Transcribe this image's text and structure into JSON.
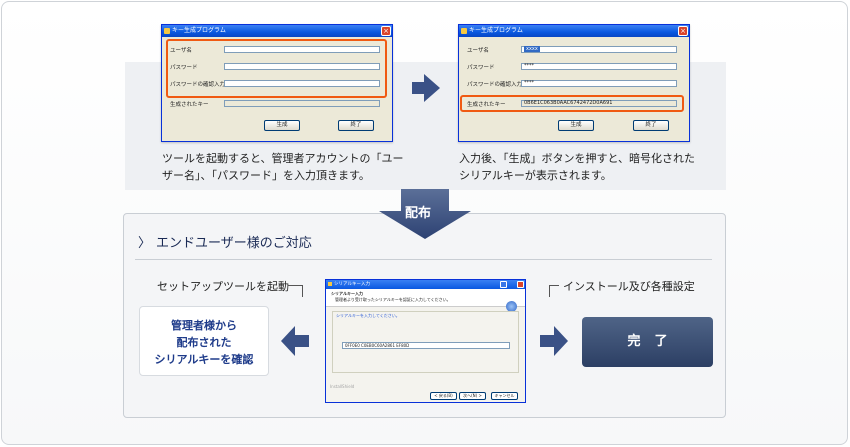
{
  "window_top_left": {
    "title": "キー生成プログラム",
    "fields": [
      {
        "label": "ユーザ名",
        "value": ""
      },
      {
        "label": "パスワード",
        "value": ""
      },
      {
        "label": "パスワードの確認入力",
        "value": ""
      }
    ],
    "output_label": "生成されたキー",
    "output_value": "",
    "generate_button": "生成",
    "exit_button": "終了"
  },
  "window_top_right": {
    "title": "キー生成プログラム",
    "fields": [
      {
        "label": "ユーザ名",
        "value": "xxxx"
      },
      {
        "label": "パスワード",
        "value": "****"
      },
      {
        "label": "パスワードの確認入力",
        "value": "****"
      }
    ],
    "output_label": "生成されたキー",
    "output_value": "0B6E1C063B0AAC6742472D0A691",
    "generate_button": "生成",
    "exit_button": "終了"
  },
  "captions": {
    "left_line1": "ツールを起動すると、管理者アカウントの「ユー",
    "left_line2": "ザー名」、「パスワード」を入力頂きます。",
    "right_line1": "入力後、「生成」ボタンを押すと、暗号化された",
    "right_line2": "シリアルキーが表示されます。"
  },
  "distribution_label": "配布",
  "panel": {
    "chevron": "〉",
    "title": "エンドユーザー様のご対応",
    "setup_label": "セットアップツールを起動",
    "install_label": "インストール及び各種設定",
    "confirm_line1": "管理者様から",
    "confirm_line2": "配布された",
    "confirm_line3": "シリアルキーを確認",
    "done_label": "完了"
  },
  "dialog": {
    "title": "シリアルキー入力",
    "header_title": "シリアルキー入力",
    "header_desc": "管理者より受け取ったシリアルキーを認証に入力してください。",
    "group_label": "シリアルキーを入力してください。",
    "key_value": "0FF0E0 C0EB0C60A2861 EF80D",
    "footer": "InstallShield",
    "back_button": "< 戻る(B)",
    "next_button": "次へ(N) >",
    "cancel_button": "キャンセル"
  },
  "colors": {
    "highlight": "#f05a12",
    "arrow": "#3a5186",
    "panel_title": "#1a2a55",
    "confirm_text": "#1e3b8a",
    "done_bg": "#2c3f64"
  }
}
